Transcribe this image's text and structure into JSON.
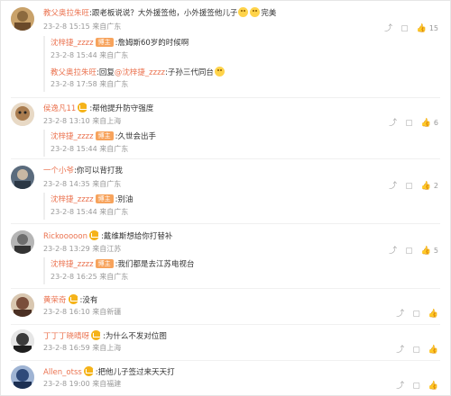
{
  "comments": [
    {
      "name": "教父奥拉朱旺",
      "text": ":跟老板说说？大外援签他，小外援签他儿子",
      "text_suffix": "完美",
      "emoji_count": 2,
      "meta": "23-2-8 15:15 来自广东",
      "likes": "15",
      "avatar_color": "#c9a26a",
      "replies": [
        {
          "name": "沈梓捷_zzzz",
          "tag": "博主",
          "text": ":詹姆斯60岁的时候啊",
          "meta": "23-2-8 15:44 来自广东"
        },
        {
          "name": "教父奥拉朱旺",
          "text": ":回复",
          "mention": "@沈梓捷_zzzz",
          "text2": ":子孙三代同台",
          "emoji_after": true,
          "meta": "23-2-8 17:58 来自广东"
        }
      ]
    },
    {
      "name": "侯逸凡11",
      "crown": true,
      "text": ":帮他提升防守强度",
      "meta": "23-2-8 13:10 来自上海",
      "likes": "6",
      "avatar_color": "#a97c4f",
      "replies": [
        {
          "name": "沈梓捷_zzzz",
          "tag": "博主",
          "text": ":久世会出手",
          "meta": "23-2-8 15:44 来自广东"
        }
      ]
    },
    {
      "name": "一个小爷",
      "text": ":你可以背打我",
      "meta": "23-2-8 14:35 来自广东",
      "likes": "2",
      "avatar_color": "#5a6b7d",
      "replies": [
        {
          "name": "沈梓捷_zzzz",
          "tag": "博主",
          "text": ":别油",
          "meta": "23-2-8 15:44 来自广东"
        }
      ]
    },
    {
      "name": "Rickooooon",
      "crown": true,
      "text": ":戴维斯想给你打替补",
      "meta": "23-2-8 13:29 来自江苏",
      "likes": "5",
      "avatar_color": "#6d6d6d",
      "replies": [
        {
          "name": "沈梓捷_zzzz",
          "tag": "博主",
          "text": ":我们都是去江苏电视台",
          "meta": "23-2-8 16:25 来自广东"
        }
      ]
    },
    {
      "name": "黄荣奇",
      "crown": true,
      "text": ":没有",
      "meta": "23-2-8 16:10 来自新疆",
      "likes": "",
      "avatar_color": "#7a4e3b",
      "replies": []
    },
    {
      "name": "丁丁丁晓晴呀",
      "crown": true,
      "text": ":为什么不发对位图",
      "meta": "23-2-8 16:59 来自上海",
      "likes": "",
      "avatar_color": "#3b3b3b",
      "replies": []
    },
    {
      "name": "Allen_otss",
      "crown": true,
      "text": ":把他儿子签过来天天打",
      "meta": "23-2-8 19:00 来自福建",
      "likes": "",
      "avatar_color": "#2f4a7a",
      "replies": []
    }
  ],
  "icons": {
    "share": "share-icon",
    "comment": "comment-icon",
    "like": "like-icon",
    "crown": "vip-crown-icon",
    "emoji": "emoji-icon"
  },
  "colors": {
    "name": "#eb7350",
    "meta": "#999999",
    "tag": "#f7a35c",
    "crown": "#f5b319"
  }
}
